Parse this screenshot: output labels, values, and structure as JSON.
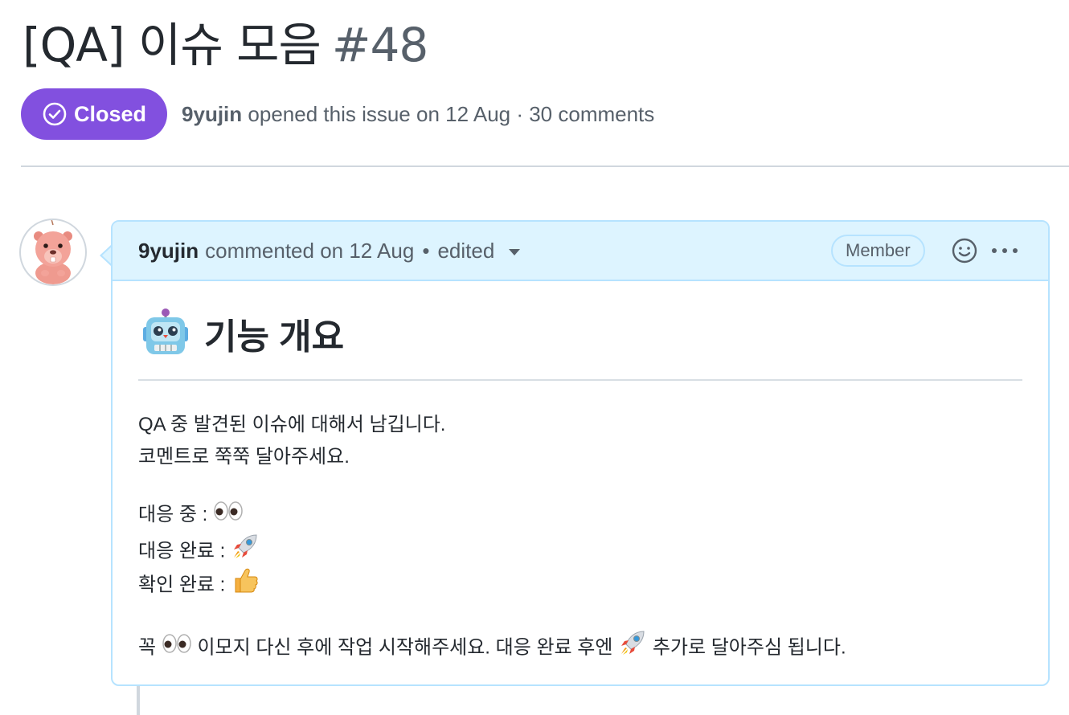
{
  "issue": {
    "title": "[QA] 이슈 모음",
    "number": "#48",
    "state": "Closed",
    "state_color": "#8250df",
    "author": "9yujin",
    "opened_text": "opened this issue on 12 Aug · 30 comments"
  },
  "comment": {
    "author": "9yujin",
    "action": "commented on 12 Aug",
    "separator": "•",
    "edited": "edited",
    "role_badge": "Member",
    "icons": {
      "reaction": "smiley-icon",
      "menu": "kebab-horizontal-icon",
      "avatar": "beaver-avatar"
    },
    "heading_emoji": "robot-emoji",
    "heading_text": "기능 개요",
    "lines": {
      "intro_1": "QA 중 발견된 이슈에 대해서 남깁니다.",
      "intro_2": "코멘트로 쭉쭉 달아주세요.",
      "status_in_progress": "대응 중 :",
      "status_done": "대응 완료 :",
      "status_confirmed": "확인 완료 :",
      "note_part1": "꼭",
      "note_part2": "이모지 다신 후에 작업 시작해주세요. 대응 완료 후엔",
      "note_part3": "추가로 달아주심 됩니다."
    },
    "status_emojis": {
      "in_progress": "eyes-emoji",
      "done": "rocket-emoji",
      "confirmed": "thumbs-up-emoji"
    }
  }
}
